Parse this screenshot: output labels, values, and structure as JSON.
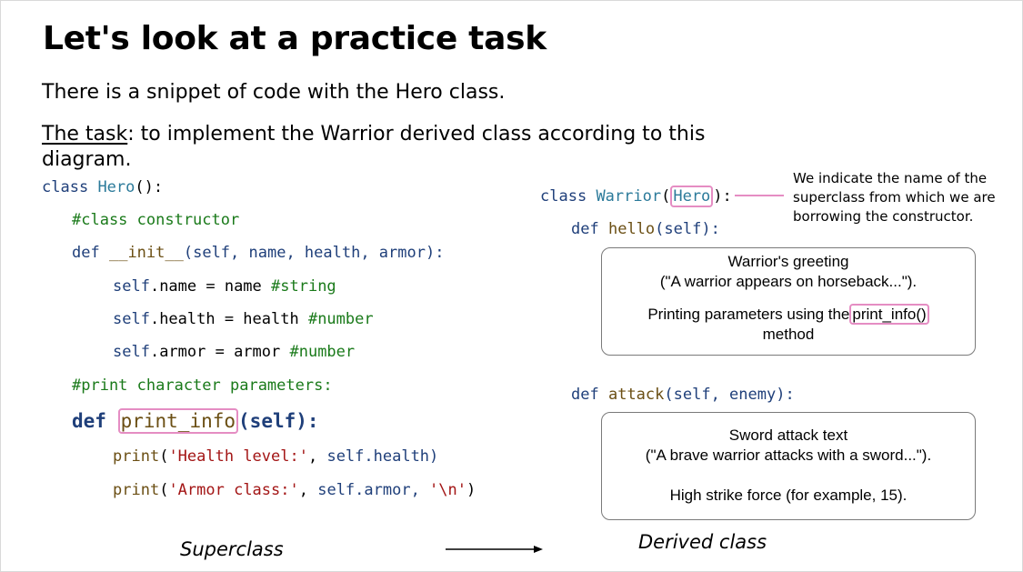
{
  "slide": {
    "title": "Let's look at a practice task",
    "intro": "There is a snippet of code with the Hero class.",
    "task_label": "The task",
    "task_text": ": to implement the Warrior derived class according to this diagram."
  },
  "superclass_code": {
    "class_kw": "class",
    "class_name": "Hero",
    "class_tail": "():",
    "comment_constructor": "#class constructor",
    "def_kw": "def",
    "init_name": "__init__",
    "init_params": "(self, name, health, armor):",
    "self_kw": "self",
    "name_attr": ".name = name ",
    "name_comment": "#string",
    "health_attr": ".health = health ",
    "health_comment": "#number",
    "armor_attr": ".armor = armor ",
    "armor_comment": "#number",
    "comment_print": "#print character parameters:",
    "print_info_name": "print_info",
    "print_info_params": "(self):",
    "print_fn": "print",
    "health_str": "'Health level:'",
    "health_args": "self.health)",
    "armor_str": "'Armor class:'",
    "armor_args": "self.armor, ",
    "newline_str": "'\\n'"
  },
  "derived_code": {
    "class_kw": "class",
    "class_name": "Warrior",
    "parent_name": "Hero",
    "class_tail": "):",
    "hello_def": "def",
    "hello_name": "hello",
    "hello_params": "(self):",
    "attack_def": "def",
    "attack_name": "attack",
    "attack_params": "(self, enemy):"
  },
  "note": "We indicate the name of the superclass from which we are borrowing the constructor.",
  "hello_box": {
    "line1": "Warrior's greeting",
    "line2": "(\"A warrior appears on horseback...\").",
    "line3_pre": "Printing parameters using the",
    "line3_hl": "print_info()",
    "line4": "method"
  },
  "attack_box": {
    "line1": "Sword attack text",
    "line2": "(\"A brave warrior attacks with a sword...\").",
    "line3": "High strike force (for example, 15)."
  },
  "captions": {
    "superclass": "Superclass",
    "derived": "Derived class"
  }
}
